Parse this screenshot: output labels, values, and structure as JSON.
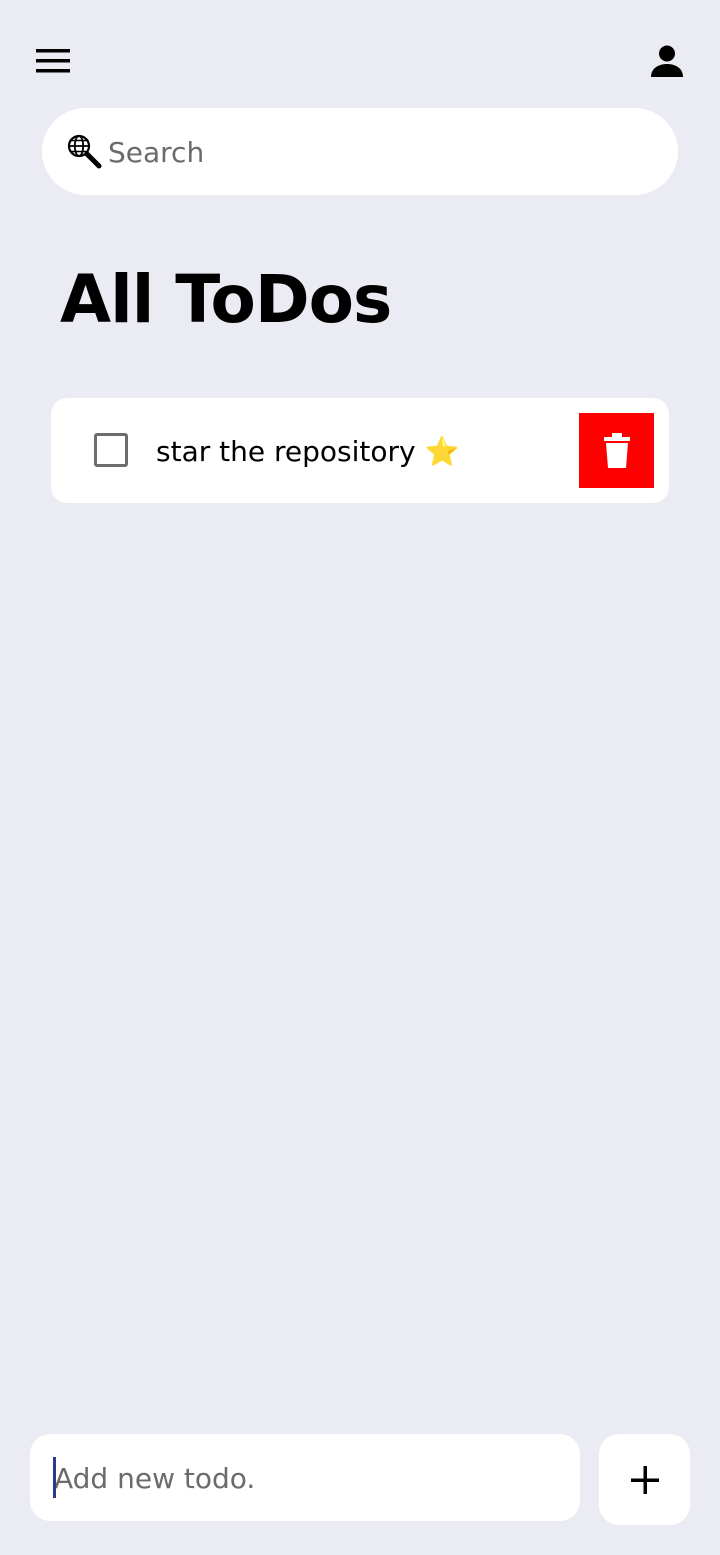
{
  "header": {
    "menu_icon": "hamburger-menu-icon",
    "profile_icon": "person-icon"
  },
  "search": {
    "placeholder": "Search",
    "value": "",
    "icon": "globe-search-icon"
  },
  "main": {
    "title": "All ToDos",
    "todos": [
      {
        "text": "star the repository ⭐",
        "checked": false,
        "delete_icon": "trash-icon"
      }
    ]
  },
  "composer": {
    "placeholder": "Add new todo.",
    "value": "",
    "add_icon": "plus-icon"
  },
  "colors": {
    "background": "#EAEBF3",
    "surface": "#FFFFFF",
    "delete": "#FF0000",
    "caret": "#2B3A8C"
  }
}
